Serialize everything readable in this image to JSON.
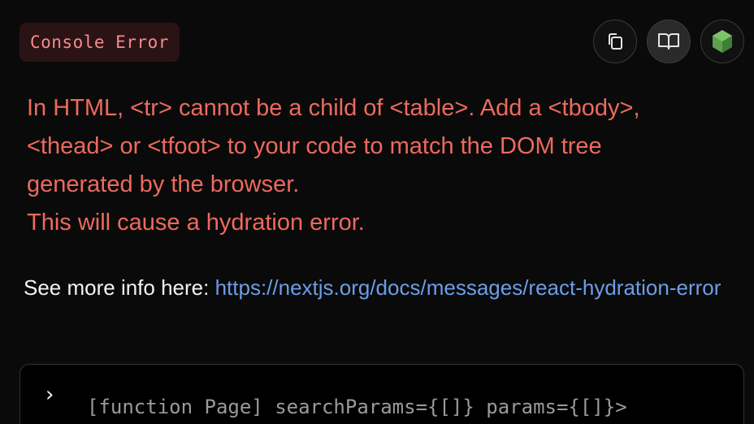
{
  "badge": {
    "label": "Console Error"
  },
  "actions": {
    "copy_icon": "copy-icon",
    "docs_icon": "book-icon",
    "runtime_icon": "nodejs-icon"
  },
  "error": {
    "lines": [
      "In HTML, <tr> cannot be a child of <table>. Add a <tbody>,",
      "<thead> or <tfoot> to your code to match the DOM tree",
      "generated by the browser.",
      "This will cause a hydration error."
    ]
  },
  "info": {
    "prefix": "See more info here: ",
    "link": "https://nextjs.org/docs/messages/react-hydration-error"
  },
  "code": {
    "chevron": "›",
    "line": "[function Page] searchParams={[]} params={[]}>"
  },
  "colors": {
    "background": "#0a0a0a",
    "error_text": "#ec6a5e",
    "badge_bg": "#2b1315",
    "badge_text": "#f28c8c",
    "link": "#6b9ee8",
    "node_green": "#5fa04e"
  }
}
